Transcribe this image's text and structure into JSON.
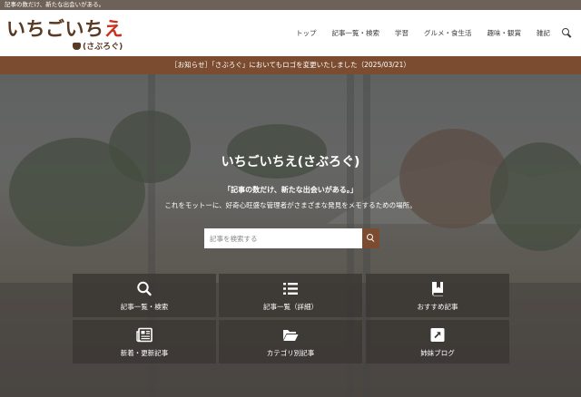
{
  "topbar": {
    "tagline": "記事の数だけ、新たな出会いがある。"
  },
  "logo": {
    "main_a": "いちごいち",
    "main_b": "え",
    "sub": "(さぶろぐ)"
  },
  "nav": {
    "items": [
      "トップ",
      "記事一覧・検索",
      "学習",
      "グルメ・食生活",
      "趣味・観賞",
      "雑記"
    ],
    "search_icon": "search-icon"
  },
  "notice": {
    "text": "［お知らせ］「さぶろぐ」においてもロゴを変更いたしました（2025/03/21）"
  },
  "hero": {
    "title": "いちごいちえ(さぶろぐ)",
    "motto": "「記事の数だけ、新たな出会いがある。」",
    "description": "これをモットーに、好奇心旺盛な管理者がさまざまな発見をメモするための場所。"
  },
  "search": {
    "placeholder": "記事を検索する"
  },
  "tiles": [
    {
      "label": "記事一覧・検索",
      "icon": "search-icon"
    },
    {
      "label": "記事一覧（詳細）",
      "icon": "list-icon"
    },
    {
      "label": "おすすめ記事",
      "icon": "bookmark-book-icon"
    },
    {
      "label": "新着・更新記事",
      "icon": "newspaper-icon"
    },
    {
      "label": "カテゴリ別記事",
      "icon": "folder-open-icon"
    },
    {
      "label": "姉妹ブログ",
      "icon": "external-link-icon"
    }
  ],
  "colors": {
    "accent": "#7b4c2f",
    "logo_brown": "#5b3a23",
    "logo_red": "#c8311d",
    "topbar": "#6e6258"
  }
}
